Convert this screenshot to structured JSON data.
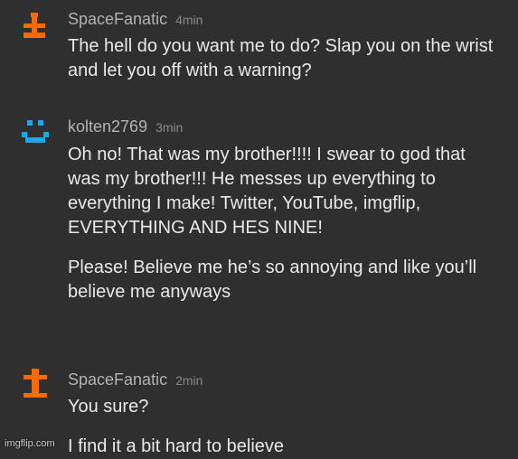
{
  "colors": {
    "background": "#2f2f2f",
    "avatar_orange": "#ff6a00",
    "avatar_blue": "#1ea7e8"
  },
  "comments": [
    {
      "avatar_icon": "orange-i-avatar-icon",
      "username": "SpaceFanatic",
      "time": "4min",
      "paragraphs": [
        "The hell do you want me to do? Slap you on the wrist and let you off with a warning?"
      ]
    },
    {
      "avatar_icon": "blue-smiley-avatar-icon",
      "username": "kolten2769",
      "time": "3min",
      "paragraphs": [
        "Oh no! That was my brother!!!! I swear to god that was my brother!!! He messes up everything to everything I make! Twitter, YouTube, imgflip, EVERYTHING AND HES NINE!",
        "Please! Believe me he’s so annoying and like you’ll believe me anyways"
      ]
    },
    {
      "avatar_icon": "orange-cross-avatar-icon",
      "username": "SpaceFanatic",
      "time": "2min",
      "paragraphs": [
        "You sure?",
        "I find it a bit hard to believe"
      ]
    }
  ],
  "watermark": "imgflip.com"
}
